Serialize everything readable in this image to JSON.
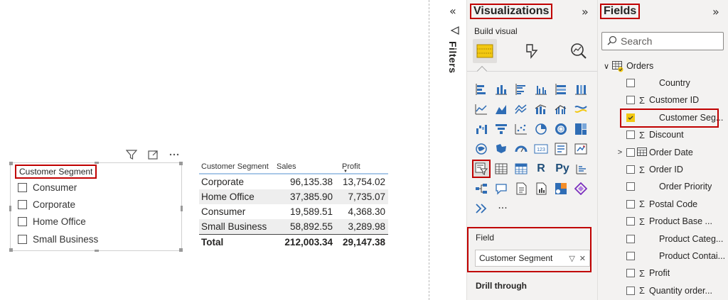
{
  "slicer": {
    "title": "Customer Segment",
    "items": [
      "Consumer",
      "Corporate",
      "Home Office",
      "Small Business"
    ],
    "toolbar": [
      "filter-icon",
      "focus-mode-icon",
      "more-options-icon"
    ]
  },
  "table": {
    "headers": [
      "Customer Segment",
      "Sales",
      "Profit"
    ],
    "rows": [
      {
        "segment": "Corporate",
        "sales": "96,135.38",
        "profit": "13,754.02"
      },
      {
        "segment": "Home Office",
        "sales": "37,385.90",
        "profit": "7,735.07"
      },
      {
        "segment": "Consumer",
        "sales": "19,589.51",
        "profit": "4,368.30"
      },
      {
        "segment": "Small Business",
        "sales": "58,892.55",
        "profit": "3,289.98"
      }
    ],
    "total": {
      "label": "Total",
      "sales": "212,003.34",
      "profit": "29,147.38"
    }
  },
  "filters": {
    "label": "Filters",
    "collapse_glyph": "«"
  },
  "visualizations": {
    "title": "Visualizations",
    "expand_glyph": "»",
    "build_visual": "Build visual",
    "icon_text_r": "R",
    "icon_text_py": "Py",
    "icon_text_123": "123",
    "more": "···",
    "field_heading": "Field",
    "field_value": "Customer Segment",
    "drill_through": "Drill through"
  },
  "fields": {
    "title": "Fields",
    "expand_glyph": "»",
    "search_placeholder": "Search",
    "table_name": "Orders",
    "items": [
      {
        "name": "Country",
        "type": "",
        "checked": false,
        "expandable": false
      },
      {
        "name": "Customer ID",
        "type": "Σ",
        "checked": false,
        "expandable": false
      },
      {
        "name": "Customer Seg...",
        "type": "",
        "checked": true,
        "expandable": false
      },
      {
        "name": "Discount",
        "type": "Σ",
        "checked": false,
        "expandable": false
      },
      {
        "name": "Order Date",
        "type": "calendar",
        "checked": false,
        "expandable": true
      },
      {
        "name": "Order ID",
        "type": "Σ",
        "checked": false,
        "expandable": false
      },
      {
        "name": "Order Priority",
        "type": "",
        "checked": false,
        "expandable": false
      },
      {
        "name": "Postal Code",
        "type": "Σ",
        "checked": false,
        "expandable": false
      },
      {
        "name": "Product Base ...",
        "type": "Σ",
        "checked": false,
        "expandable": false
      },
      {
        "name": "Product Categ...",
        "type": "",
        "checked": false,
        "expandable": false
      },
      {
        "name": "Product Contai...",
        "type": "",
        "checked": false,
        "expandable": false
      },
      {
        "name": "Profit",
        "type": "Σ",
        "checked": false,
        "expandable": false
      },
      {
        "name": "Quantity order...",
        "type": "Σ",
        "checked": false,
        "expandable": false
      }
    ]
  },
  "colors": {
    "highlight_border": "#c00000",
    "check_yellow": "#f2c811",
    "pane_bg": "#f3f2f1",
    "table_header_rule": "#a9c8e8"
  }
}
